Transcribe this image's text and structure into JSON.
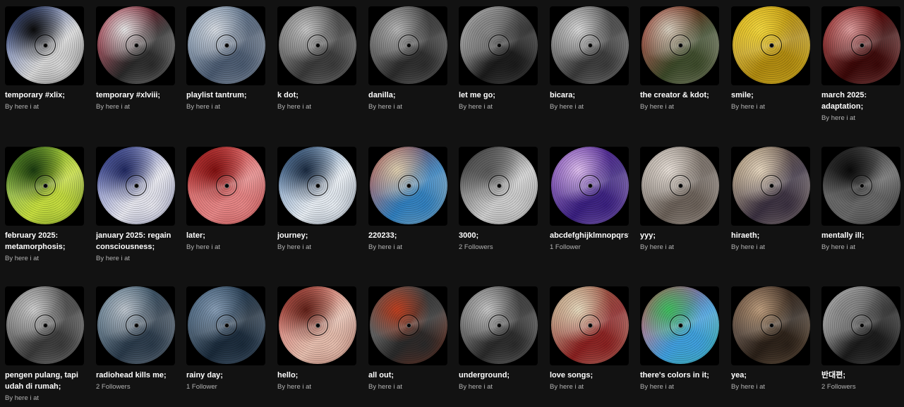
{
  "playlists": [
    {
      "title": "temporary #xlix;",
      "subtitle": "By here i at",
      "colors": [
        "#1f3b8c",
        "#d9d9d9",
        "#0a0a0a"
      ]
    },
    {
      "title": "temporary #xlviii;",
      "subtitle": "By here i at",
      "colors": [
        "#c8324a",
        "#2a2a2a",
        "#e8e8e8"
      ]
    },
    {
      "title": "playlist tantrum;",
      "subtitle": "By here i at",
      "colors": [
        "#9ab0c8",
        "#4a5a70",
        "#d8dde4"
      ]
    },
    {
      "title": "k dot;",
      "subtitle": "By here i at",
      "colors": [
        "#8a8a8a",
        "#3a3a3a",
        "#c8c8c8"
      ]
    },
    {
      "title": "danilla;",
      "subtitle": "By here i at",
      "colors": [
        "#7a7a7a",
        "#2c2c2c",
        "#b8b8b8"
      ]
    },
    {
      "title": "let me go;",
      "subtitle": "By here i at",
      "colors": [
        "#e0e0e0",
        "#1a1a1a",
        "#8a8a8a"
      ]
    },
    {
      "title": "bicara;",
      "subtitle": "By here i at",
      "colors": [
        "#9a9a9a",
        "#3a3a3a",
        "#dadada"
      ]
    },
    {
      "title": "the creator & kdot;",
      "subtitle": "By here i at",
      "colors": [
        "#a82820",
        "#3c4a2a",
        "#d8d0c0"
      ]
    },
    {
      "title": "smile;",
      "subtitle": "By here i at",
      "colors": [
        "#e8c020",
        "#b08a10",
        "#f4d840"
      ]
    },
    {
      "title": "march 2025: adaptation;",
      "subtitle": "By here i at",
      "colors": [
        "#a01c1c",
        "#3a0808",
        "#e0a0a0"
      ]
    },
    {
      "title": "february 2025: metamorphosis;",
      "subtitle": "By here i at",
      "colors": [
        "#4a8a2a",
        "#c8e040",
        "#1a3a10"
      ]
    },
    {
      "title": "january 2025: regain consciousness;",
      "subtitle": "By here i at",
      "colors": [
        "#3040a0",
        "#e8e8f0",
        "#202860"
      ]
    },
    {
      "title": "later;",
      "subtitle": "By here i at",
      "colors": [
        "#c02828",
        "#e88888",
        "#801010"
      ]
    },
    {
      "title": "journey;",
      "subtitle": "By here i at",
      "colors": [
        "#3a6aa0",
        "#e8eef4",
        "#1a2a40"
      ]
    },
    {
      "title": "220233;",
      "subtitle": "By here i at",
      "colors": [
        "#c04030",
        "#3080c0",
        "#e0d0b0"
      ]
    },
    {
      "title": "3000;",
      "subtitle": "2 Followers",
      "colors": [
        "#1a1a1a",
        "#d0d0d0",
        "#5a5a5a"
      ]
    },
    {
      "title": "abcdefghijklmnopqrstuvwxyz;",
      "subtitle": "1 Follower",
      "colors": [
        "#8a50c0",
        "#3a2080",
        "#e0c0f0"
      ]
    },
    {
      "title": "yyy;",
      "subtitle": "By here i at",
      "colors": [
        "#c0b8b0",
        "#6a6058",
        "#e8e0d8"
      ]
    },
    {
      "title": "hiraeth;",
      "subtitle": "By here i at",
      "colors": [
        "#c0a880",
        "#3a3040",
        "#e8d8c0"
      ]
    },
    {
      "title": "mentally ill;",
      "subtitle": "By here i at",
      "colors": [
        "#2a2a2a",
        "#6a6a6a",
        "#0a0a0a"
      ]
    },
    {
      "title": "pengen pulang, tapi udah di rumah;",
      "subtitle": "By here i at",
      "colors": [
        "#9a9a9a",
        "#3a3a3a",
        "#d0d0d0"
      ]
    },
    {
      "title": "radiohead kills me;",
      "subtitle": "2 Followers",
      "colors": [
        "#6a8aa0",
        "#2a3a4a",
        "#c0c8d0"
      ]
    },
    {
      "title": "rainy day;",
      "subtitle": "1 Follower",
      "colors": [
        "#4a6a88",
        "#1a2a3a",
        "#8aa0b8"
      ]
    },
    {
      "title": "hello;",
      "subtitle": "By here i at",
      "colors": [
        "#c04038",
        "#e8c0b0",
        "#602018"
      ]
    },
    {
      "title": "all out;",
      "subtitle": "By here i at",
      "colors": [
        "#6a6a6a",
        "#2a2a2a",
        "#c04020"
      ]
    },
    {
      "title": "underground;",
      "subtitle": "By here i at",
      "colors": [
        "#8a8a8a",
        "#2a2a2a",
        "#c8c8c8"
      ]
    },
    {
      "title": "love songs;",
      "subtitle": "By here i at",
      "colors": [
        "#c8b890",
        "#8a2020",
        "#e8dcc0"
      ]
    },
    {
      "title": "there's colors in it;",
      "subtitle": "By here i at",
      "colors": [
        "#e04040",
        "#40a0e0",
        "#40c060"
      ]
    },
    {
      "title": "yea;",
      "subtitle": "By here i at",
      "colors": [
        "#6a5040",
        "#2a2018",
        "#c0a080"
      ]
    },
    {
      "title": "반대편;",
      "subtitle": "2 Followers",
      "colors": [
        "#e8e8e8",
        "#1a1a1a",
        "#8a8a8a"
      ]
    }
  ]
}
